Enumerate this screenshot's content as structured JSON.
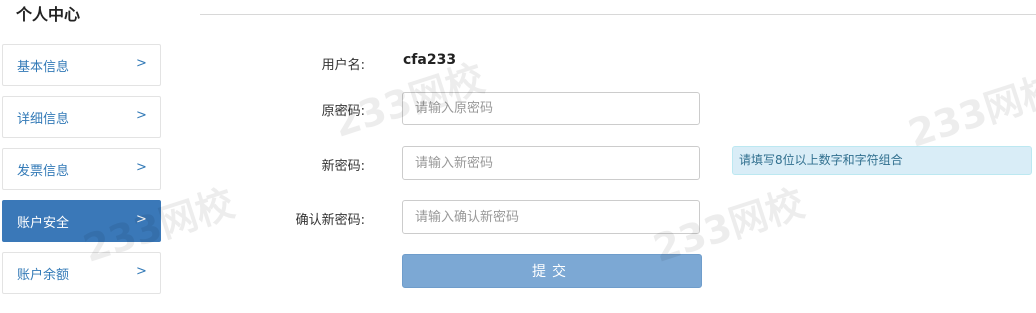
{
  "page": {
    "title": "个人中心"
  },
  "sidebar": {
    "items": [
      {
        "label": "基本信息",
        "chevron": ">"
      },
      {
        "label": "详细信息",
        "chevron": ">"
      },
      {
        "label": "发票信息",
        "chevron": ">"
      },
      {
        "label": "账户安全",
        "chevron": ">",
        "active": true
      },
      {
        "label": "账户余额",
        "chevron": ">"
      }
    ],
    "active_color": "#3a78b8",
    "link_color": "#337ab7"
  },
  "form": {
    "username_label": "用户名:",
    "username_value": "cfa233",
    "old_password_label": "原密码:",
    "old_password_placeholder": "请输入原密码",
    "new_password_label": "新密码:",
    "new_password_placeholder": "请输入新密码",
    "new_password_hint": "请填写8位以上数字和字符组合",
    "confirm_password_label": "确认新密码:",
    "confirm_password_placeholder": "请输入确认新密码",
    "submit_label": "提交"
  },
  "watermark": {
    "text": "233网校"
  }
}
